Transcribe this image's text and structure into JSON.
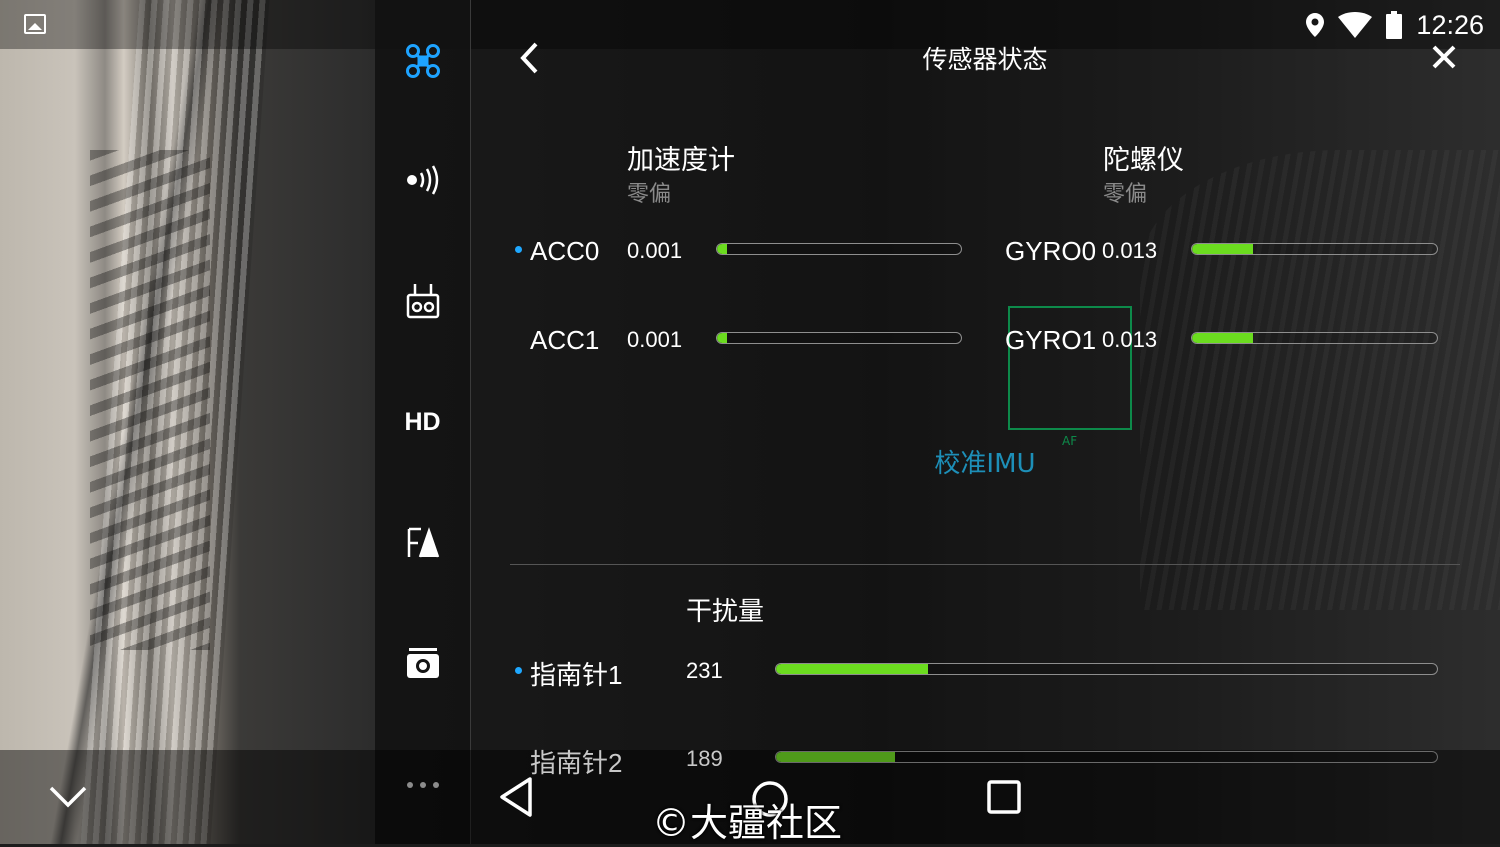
{
  "status": {
    "time": "12:26"
  },
  "panel": {
    "title": "传感器状态"
  },
  "sidebar": {
    "hd_label": "HD"
  },
  "accelerometer": {
    "title": "加速度计",
    "subtitle": "零偏",
    "rows": [
      {
        "label": "ACC0",
        "value": "0.001",
        "level": 0.04,
        "selected": true
      },
      {
        "label": "ACC1",
        "value": "0.001",
        "level": 0.04,
        "selected": false
      }
    ]
  },
  "gyroscope": {
    "title": "陀螺仪",
    "subtitle": "零偏",
    "rows": [
      {
        "label": "GYRO0",
        "value": "0.013",
        "level": 0.25
      },
      {
        "label": "GYRO1",
        "value": "0.013",
        "level": 0.25
      }
    ]
  },
  "calibrate_imu": "校准IMU",
  "compass": {
    "title": "干扰量",
    "rows": [
      {
        "label": "指南针1",
        "value": "231",
        "level": 0.23,
        "selected": true
      },
      {
        "label": "指南针2",
        "value": "189",
        "level": 0.18,
        "selected": false
      }
    ]
  },
  "camera": {
    "focus_label": "AF"
  },
  "watermark": "©大疆社区",
  "colors": {
    "accent_green": "#6bdc1f",
    "link_blue": "#1d8fb8",
    "select_dot": "#1fa8ff"
  }
}
